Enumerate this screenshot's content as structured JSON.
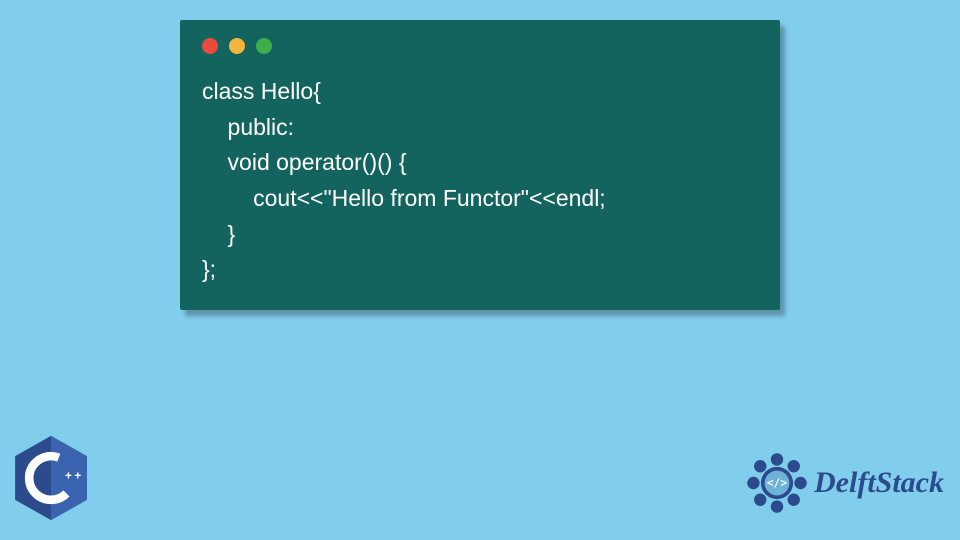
{
  "window": {
    "dots": [
      "red",
      "yellow",
      "green"
    ]
  },
  "code": {
    "line1": "class Hello{",
    "line2": "    public:",
    "line3": "    void operator()() {",
    "line4": "        cout<<\"Hello from Functor\"<<endl;",
    "line5": "    }",
    "line6": "};"
  },
  "badges": {
    "cpp_label": "C++",
    "brand": "DelftStack"
  }
}
